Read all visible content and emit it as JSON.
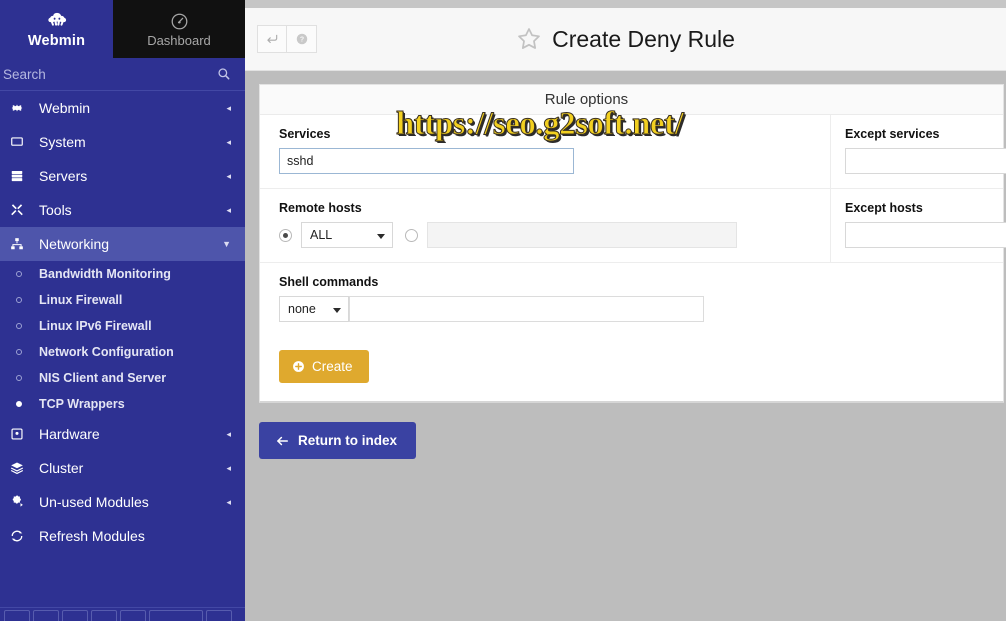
{
  "sidebar": {
    "brand": {
      "name": "Webmin",
      "logo_icon": "webmin-logo-icon"
    },
    "dashboard_tab": {
      "label": "Dashboard",
      "icon": "speedometer-icon"
    },
    "search": {
      "placeholder": "Search",
      "value": "",
      "icon": "search-icon"
    },
    "menu": [
      {
        "label": "Webmin",
        "icon": "gear-icon",
        "caret": "◂",
        "active": false
      },
      {
        "label": "System",
        "icon": "monitor-icon",
        "caret": "◂",
        "active": false
      },
      {
        "label": "Servers",
        "icon": "server-icon",
        "caret": "◂",
        "active": false
      },
      {
        "label": "Tools",
        "icon": "tools-icon",
        "caret": "◂",
        "active": false
      },
      {
        "label": "Networking",
        "icon": "network-icon",
        "caret": "▼",
        "active": true
      }
    ],
    "submenu": [
      {
        "label": "Bandwidth Monitoring",
        "current": false
      },
      {
        "label": "Linux Firewall",
        "current": false
      },
      {
        "label": "Linux IPv6 Firewall",
        "current": false
      },
      {
        "label": "Network Configuration",
        "current": false
      },
      {
        "label": "NIS Client and Server",
        "current": false
      },
      {
        "label": "TCP Wrappers",
        "current": true
      }
    ],
    "menu_after": [
      {
        "label": "Hardware",
        "icon": "hardware-icon",
        "caret": "◂"
      },
      {
        "label": "Cluster",
        "icon": "layers-icon",
        "caret": "◂"
      },
      {
        "label": "Un-used Modules",
        "icon": "puzzle-icon",
        "caret": "◂"
      },
      {
        "label": "Refresh Modules",
        "icon": "refresh-icon",
        "caret": ""
      }
    ]
  },
  "header": {
    "back_button_icon": "return-arrow-icon",
    "help_button_icon": "help-circle-icon",
    "favorite_icon": "star-outline-icon",
    "title": "Create Deny Rule"
  },
  "card": {
    "heading": "Rule options",
    "services": {
      "label": "Services",
      "value": "sshd",
      "placeholder": ""
    },
    "except_services": {
      "label": "Except services",
      "value": "",
      "placeholder": ""
    },
    "remote_hosts": {
      "label": "Remote hosts",
      "mode_all_selected": true,
      "select_value": "ALL",
      "custom_value": "",
      "custom_placeholder": ""
    },
    "except_hosts": {
      "label": "Except hosts",
      "value": "",
      "placeholder": ""
    },
    "shell_commands": {
      "label": "Shell commands",
      "select_value": "none",
      "value": "",
      "placeholder": ""
    },
    "create_button": {
      "label": "Create",
      "icon": "plus-circle-icon"
    }
  },
  "footer": {
    "return_button": {
      "label": "Return to index",
      "icon": "arrow-left-icon"
    }
  },
  "watermark": {
    "text": "https://seo.g2soft.net/"
  },
  "colors": {
    "sidebar_blue": "#2e3192",
    "sidebar_active": "#4e55ab",
    "dashboard_tab": "#111111",
    "page_background": "#bdbdbd",
    "create_button": "#dfa92e",
    "return_button": "#3a42a2",
    "watermark_yellow": "#f2d021"
  }
}
